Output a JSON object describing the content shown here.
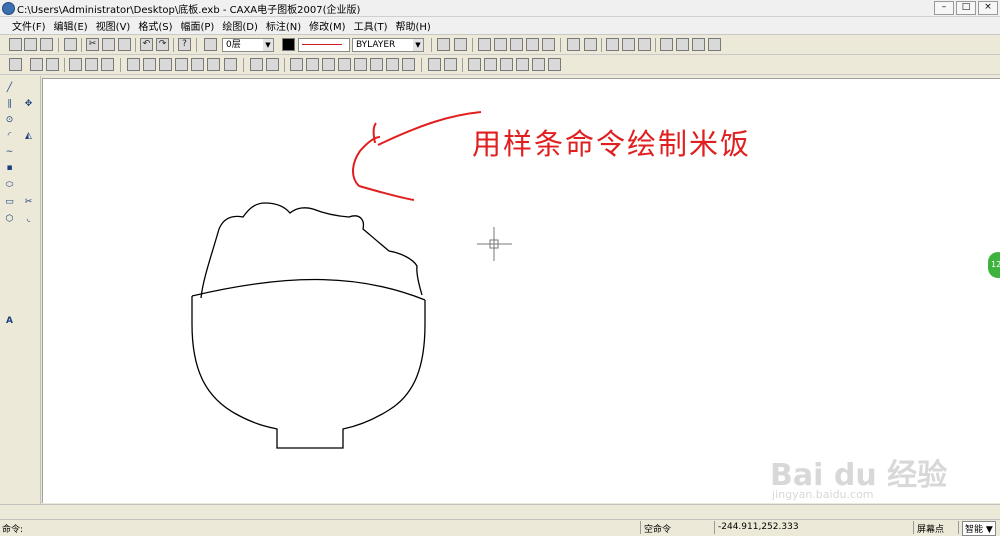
{
  "window": {
    "title": "C:\\Users\\Administrator\\Desktop\\底板.exb - CAXA电子图板2007(企业版)",
    "controls": [
      "–",
      "□",
      "×"
    ]
  },
  "menu": [
    "文件(F)",
    "编辑(E)",
    "视图(V)",
    "格式(S)",
    "幅面(P)",
    "绘图(D)",
    "标注(N)",
    "修改(M)",
    "工具(T)",
    "帮助(H)"
  ],
  "toolbar": {
    "layer_value": "0层",
    "linetype_value": "BYLAYER"
  },
  "canvas": {
    "annotation": "用样条命令绘制米饭",
    "annotation_color": "#e02020"
  },
  "sidebar": {
    "float_button": "12"
  },
  "watermark": {
    "brand": "Bai du 经验",
    "site": "jingyan.baidu.com"
  },
  "status": {
    "command_prompt": "命令:",
    "mode": "空命令",
    "coordinates": "-244.911,252.333",
    "snap": "屏幕点",
    "smart": "智能"
  }
}
